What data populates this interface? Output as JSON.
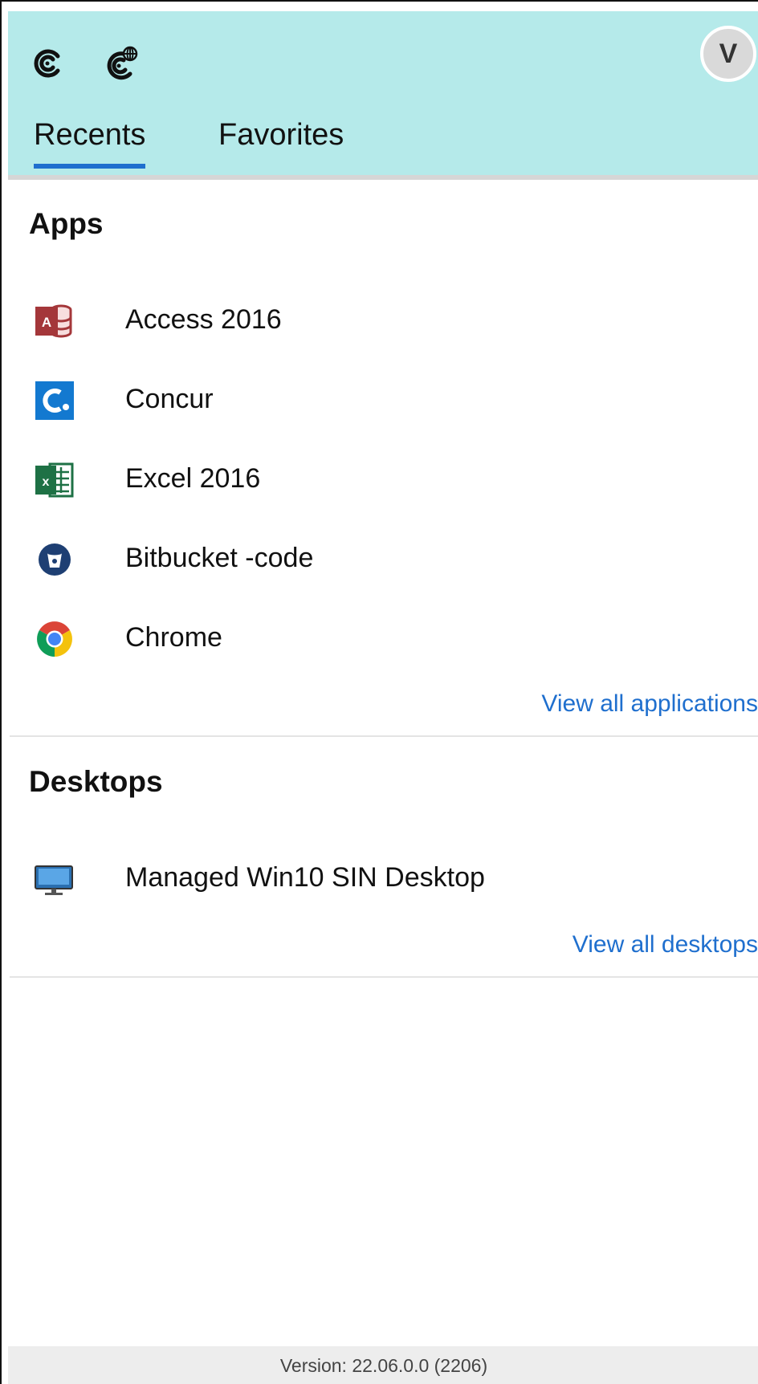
{
  "header": {
    "icons": [
      "workspace-icon",
      "workspace-web-icon"
    ],
    "avatar_initial": "V",
    "background": "#b5eaea"
  },
  "tabs": [
    {
      "label": "Recents",
      "active": true
    },
    {
      "label": "Favorites",
      "active": false
    }
  ],
  "apps": {
    "title": "Apps",
    "items": [
      {
        "label": "Access 2016",
        "icon": "access-icon"
      },
      {
        "label": "Concur",
        "icon": "concur-icon"
      },
      {
        "label": "Excel 2016",
        "icon": "excel-icon"
      },
      {
        "label": "Bitbucket -code",
        "icon": "bitbucket-icon"
      },
      {
        "label": "Chrome",
        "icon": "chrome-icon"
      }
    ],
    "view_all": "View all applications"
  },
  "desktops": {
    "title": "Desktops",
    "items": [
      {
        "label": "Managed Win10 SIN Desktop",
        "icon": "monitor-icon"
      }
    ],
    "view_all": "View all desktops"
  },
  "footer": {
    "version": "Version: 22.06.0.0 (2206)"
  },
  "colors": {
    "accent": "#1f6fce",
    "header_bg": "#b5eaea",
    "footer_bg": "#ededed"
  }
}
